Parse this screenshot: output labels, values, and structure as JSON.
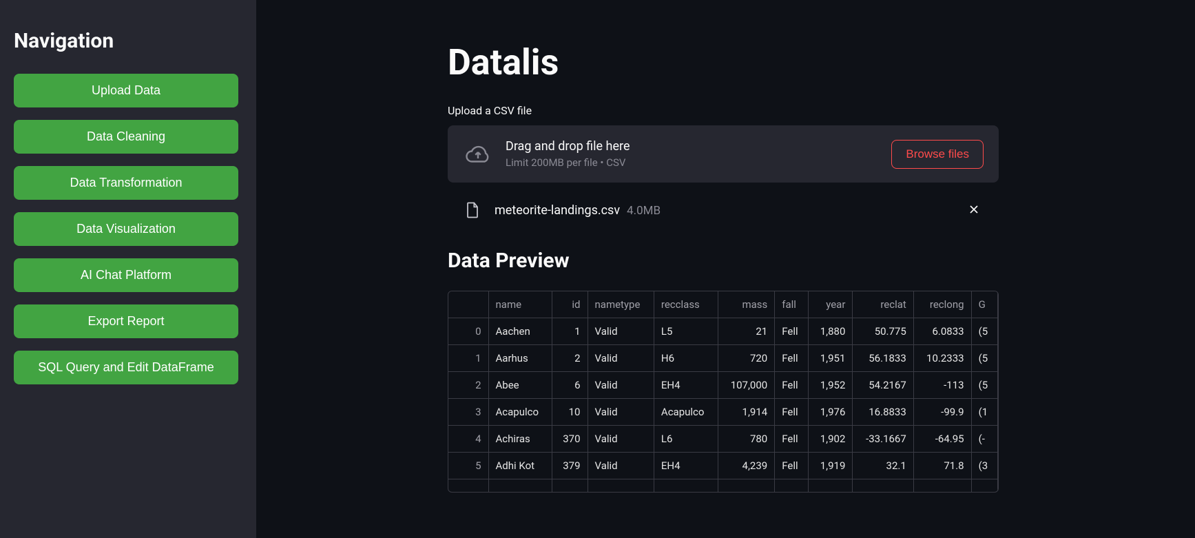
{
  "sidebar": {
    "title": "Navigation",
    "items": [
      "Upload Data",
      "Data Cleaning",
      "Data Transformation",
      "Data Visualization",
      "AI Chat Platform",
      "Export Report",
      "SQL Query and Edit DataFrame"
    ]
  },
  "app": {
    "title": "Datalis"
  },
  "upload": {
    "label": "Upload a CSV file",
    "drop_title": "Drag and drop file here",
    "drop_sub": "Limit 200MB per file • CSV",
    "browse": "Browse files"
  },
  "file": {
    "name": "meteorite-landings.csv",
    "size": "4.0MB"
  },
  "preview": {
    "title": "Data Preview",
    "headers": [
      "",
      "name",
      "id",
      "nametype",
      "recclass",
      "mass",
      "fall",
      "year",
      "reclat",
      "reclong",
      "G"
    ],
    "rows": [
      [
        "0",
        "Aachen",
        "1",
        "Valid",
        "L5",
        "21",
        "Fell",
        "1,880",
        "50.775",
        "6.0833",
        "(5"
      ],
      [
        "1",
        "Aarhus",
        "2",
        "Valid",
        "H6",
        "720",
        "Fell",
        "1,951",
        "56.1833",
        "10.2333",
        "(5"
      ],
      [
        "2",
        "Abee",
        "6",
        "Valid",
        "EH4",
        "107,000",
        "Fell",
        "1,952",
        "54.2167",
        "-113",
        "(5"
      ],
      [
        "3",
        "Acapulco",
        "10",
        "Valid",
        "Acapulco",
        "1,914",
        "Fell",
        "1,976",
        "16.8833",
        "-99.9",
        "(1"
      ],
      [
        "4",
        "Achiras",
        "370",
        "Valid",
        "L6",
        "780",
        "Fell",
        "1,902",
        "-33.1667",
        "-64.95",
        "(-"
      ],
      [
        "5",
        "Adhi Kot",
        "379",
        "Valid",
        "EH4",
        "4,239",
        "Fell",
        "1,919",
        "32.1",
        "71.8",
        "(3"
      ]
    ]
  }
}
